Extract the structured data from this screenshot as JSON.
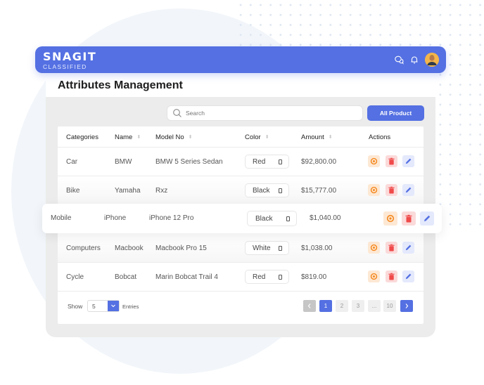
{
  "app": {
    "logo_main": "SNAGIT",
    "logo_sub": "CLASSIFIED",
    "brand_color": "#5470e2"
  },
  "topbar_icons": [
    "chat-icon",
    "bell-icon",
    "avatar"
  ],
  "page": {
    "title": "Attributes Management"
  },
  "toolbar": {
    "search_placeholder": "Search",
    "all_product_label": "All Product"
  },
  "table": {
    "headers": [
      "Categories",
      "Name",
      "Model No",
      "Color",
      "Amount",
      "Actions"
    ],
    "sortable": [
      false,
      true,
      true,
      true,
      true,
      false
    ],
    "rows": [
      {
        "category": "Car",
        "name": "BMW",
        "model": "BMW 5 Series Sedan",
        "color": "Red",
        "amount": "$92,800.00"
      },
      {
        "category": "Bike",
        "name": "Yamaha",
        "model": "Rxz",
        "color": "Black",
        "amount": "$15,777.00"
      },
      {
        "category": "Mobile",
        "name": "iPhone",
        "model": "iPhone 12 Pro",
        "color": "Black",
        "amount": "$1,040.00",
        "highlighted": true
      },
      {
        "category": "Computers",
        "name": "Macbook",
        "model": "Macbook Pro 15",
        "color": "White",
        "amount": "$1,038.00"
      },
      {
        "category": "Cycle",
        "name": "Bobcat",
        "model": "Marin Bobcat Trail 4",
        "color": "Red",
        "amount": "$819.00"
      }
    ],
    "action_icons": [
      "eye-icon",
      "trash-icon",
      "pencil-icon"
    ],
    "action_colors": {
      "view": "#f5891f",
      "delete": "#f04a4a",
      "edit": "#5470e2"
    }
  },
  "footer": {
    "show_label": "Show",
    "page_size": "5",
    "entries_label": "Entries",
    "pages": [
      "1",
      "2",
      "3",
      "...",
      "10"
    ],
    "current_page": "1",
    "prev_icon": "chevron-left-icon",
    "next_icon": "chevron-right-icon"
  }
}
